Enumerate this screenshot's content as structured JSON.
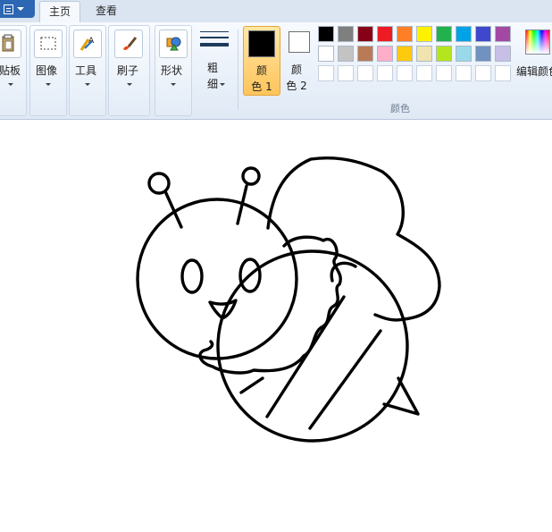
{
  "tabs": {
    "home": "主页",
    "view": "查看"
  },
  "ribbon": {
    "clipboard": {
      "label": "贴板"
    },
    "image": {
      "label": "图像"
    },
    "tools": {
      "label": "工具"
    },
    "brushes": {
      "label": "刷子"
    },
    "shapes": {
      "label": "形状"
    },
    "size": {
      "label_top": "粗",
      "label_bottom": "细"
    },
    "color1": {
      "label_top": "颜",
      "label_bottom": "色 1",
      "value": "#000000"
    },
    "color2": {
      "label_top": "颜",
      "label_bottom": "色 2",
      "value": "#ffffff"
    },
    "colors_group_label": "颜色",
    "edit_colors": {
      "label": "编辑颜色"
    }
  },
  "palette": {
    "row1": [
      "#000000",
      "#7f7f7f",
      "#880015",
      "#ed1c24",
      "#ff7f27",
      "#fff200",
      "#22b14c",
      "#00a2e8",
      "#3f48cc",
      "#a349a4"
    ],
    "row2": [
      "#ffffff",
      "#c3c3c3",
      "#b97a57",
      "#ffaec9",
      "#ffc90e",
      "#efe4b0",
      "#b5e61d",
      "#99d9ea",
      "#7092be",
      "#c8bfe7"
    ],
    "row3": [
      "#ffffff",
      "#ffffff",
      "#ffffff",
      "#ffffff",
      "#ffffff",
      "#ffffff",
      "#ffffff",
      "#ffffff",
      "#ffffff",
      "#ffffff"
    ]
  }
}
